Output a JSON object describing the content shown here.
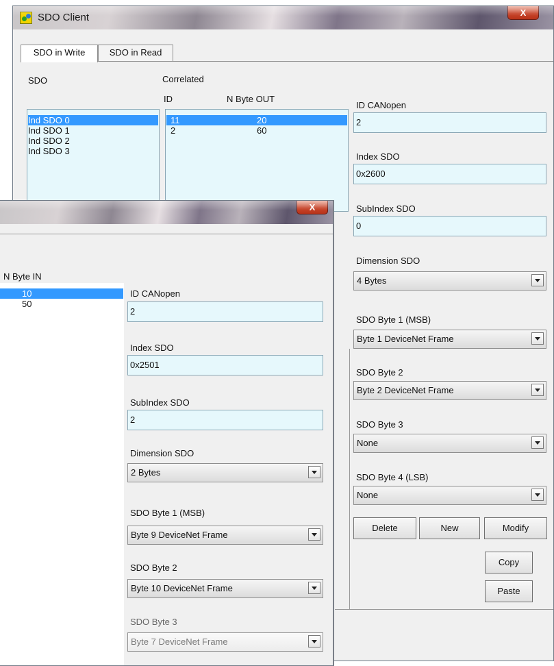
{
  "back": {
    "title": "SDO Client",
    "close": "X",
    "tabs": [
      "SDO in Write",
      "SDO in Read"
    ],
    "sdo_header": "SDO",
    "correlated_header": "Correlated",
    "id_header": "ID",
    "nbyte_header": "N Byte OUT",
    "sdo_list": [
      "Ind SDO 0",
      "Ind SDO 1",
      "Ind SDO 2",
      "Ind SDO 3"
    ],
    "correlated_rows": [
      {
        "id": "11",
        "n": "20"
      },
      {
        "id": "2",
        "n": "60"
      }
    ],
    "id_canopen_label": "ID CANopen",
    "id_canopen_value": "2",
    "index_label": "Index SDO",
    "index_value": "0x2600",
    "subindex_label": "SubIndex SDO",
    "subindex_value": "0",
    "dimension_label": "Dimension SDO",
    "dimension_value": "4 Bytes",
    "byte1_label": "SDO Byte 1 (MSB)",
    "byte1_value": "Byte 1 DeviceNet Frame",
    "byte2_label": "SDO Byte 2",
    "byte2_value": "Byte 2 DeviceNet Frame",
    "byte3_label": "SDO Byte 3",
    "byte3_value": "None",
    "byte4_label": "SDO Byte 4 (LSB)",
    "byte4_value": "None",
    "buttons": {
      "delete": "Delete",
      "new": "New",
      "modify": "Modify",
      "copy": "Copy",
      "paste": "Paste"
    }
  },
  "front": {
    "close": "X",
    "nbyte_header": "N Byte IN",
    "rows": [
      "10",
      "50"
    ],
    "id_canopen_label": "ID CANopen",
    "id_canopen_value": "2",
    "index_label": "Index SDO",
    "index_value": "0x2501",
    "subindex_label": "SubIndex SDO",
    "subindex_value": "2",
    "dimension_label": "Dimension SDO",
    "dimension_value": "2 Bytes",
    "byte1_label": "SDO Byte 1 (MSB)",
    "byte1_value": "Byte 9 DeviceNet Frame",
    "byte2_label": "SDO Byte 2",
    "byte2_value": "Byte 10 DeviceNet Frame",
    "byte3_label": "SDO Byte 3",
    "byte3_value": "Byte 7 DeviceNet Frame"
  }
}
